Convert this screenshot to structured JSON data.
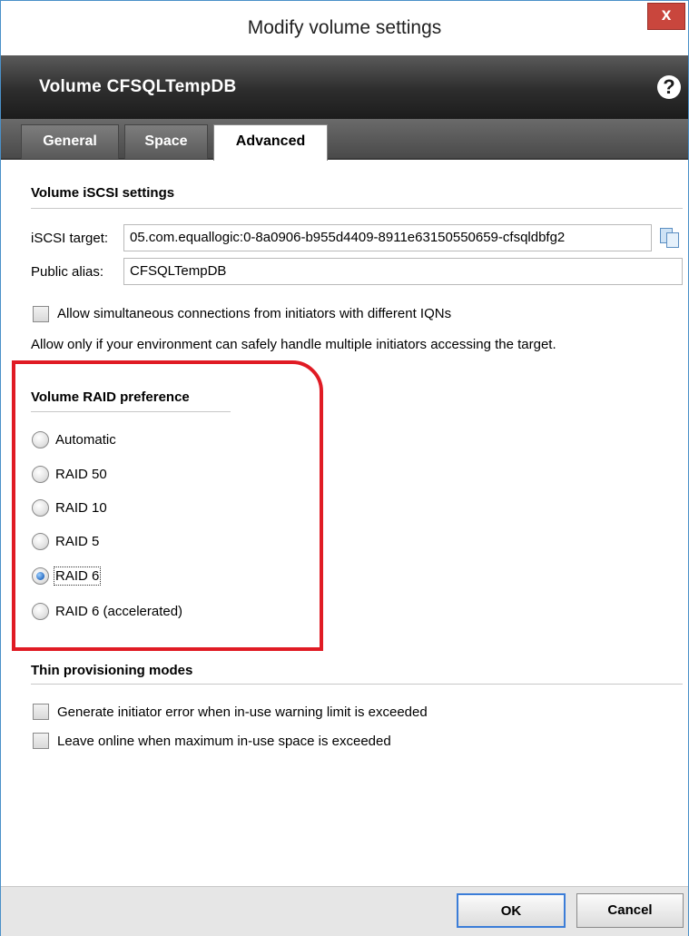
{
  "window": {
    "title": "Modify volume settings",
    "close_label": "x"
  },
  "header": {
    "volume_title": "Volume CFSQLTempDB",
    "help_label": "?"
  },
  "tabs": [
    {
      "label": "General",
      "active": false
    },
    {
      "label": "Space",
      "active": false
    },
    {
      "label": "Advanced",
      "active": true
    }
  ],
  "iscsi": {
    "heading": "Volume iSCSI settings",
    "target_label": "iSCSI target:",
    "target_value": "05.com.equallogic:0-8a0906-b955d4409-8911e63150550659-cfsqldbfg2",
    "alias_label": "Public alias:",
    "alias_value": "CFSQLTempDB",
    "allow_simultaneous_label": "Allow simultaneous connections from initiators with different IQNs",
    "allow_simultaneous_checked": false,
    "note": "Allow only if your environment can safely handle multiple initiators accessing the target."
  },
  "raid": {
    "heading": "Volume RAID preference",
    "options": [
      {
        "label": "Automatic",
        "selected": false
      },
      {
        "label": "RAID 50",
        "selected": false
      },
      {
        "label": "RAID 10",
        "selected": false
      },
      {
        "label": "RAID 5",
        "selected": false
      },
      {
        "label": "RAID 6",
        "selected": true
      },
      {
        "label": "RAID 6 (accelerated)",
        "selected": false
      }
    ],
    "highlight_color": "#e01b24"
  },
  "thin": {
    "heading": "Thin provisioning modes",
    "options": [
      {
        "label": "Generate initiator error when in-use warning limit is exceeded",
        "checked": false
      },
      {
        "label": "Leave online when maximum in-use space is exceeded",
        "checked": false
      }
    ]
  },
  "footer": {
    "ok_label": "OK",
    "cancel_label": "Cancel"
  },
  "colors": {
    "header_dark": "#1c1c1c",
    "close_red": "#c9463d",
    "radio_selected_blue": "#2b6fc4"
  }
}
